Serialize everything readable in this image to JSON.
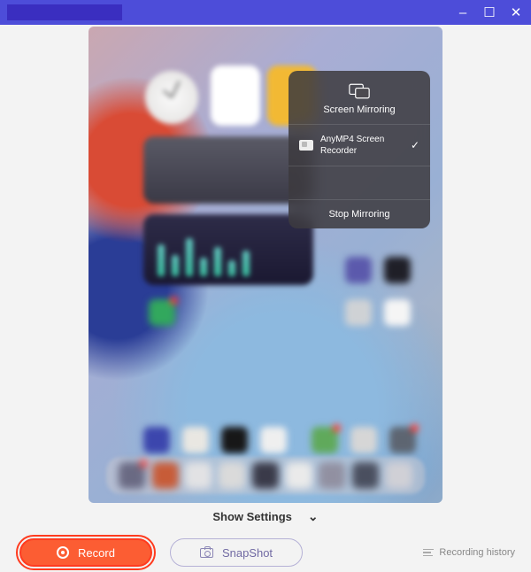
{
  "window": {
    "minimize": "–",
    "maximize": "☐",
    "close": "✕"
  },
  "mirroring": {
    "title": "Screen Mirroring",
    "device": "AnyMP4 Screen Recorder",
    "check": "✓",
    "stop": "Stop Mirroring"
  },
  "footer": {
    "show_settings": "Show Settings",
    "record": "Record",
    "snapshot": "SnapShot",
    "history": "Recording history"
  }
}
